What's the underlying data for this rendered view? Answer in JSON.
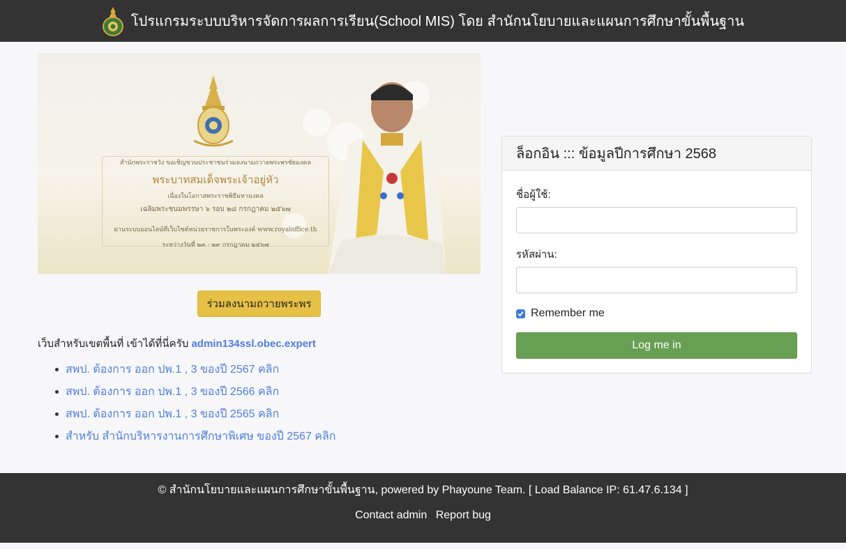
{
  "header": {
    "title": "โปรแกรมระบบบริหารจัดการผลการเรียน(School MIS) โดย สำนักนโยบายและแผนการศึกษาขั้นพื้นฐาน",
    "logo_icon": "obec-emblem-icon"
  },
  "banner": {
    "line1": "สำนักพระราชวัง ขอเชิญชวนประชาชนร่วมลงนามถวายพระพรชัยมงคล",
    "line2": "พระบาทสมเด็จพระเจ้าอยู่หัว",
    "line3": "เนื่องในโอกาสพระราชพิธีมหามงคล",
    "line4": "เฉลิมพระชนมพรรษา ๖ รอบ ๒๘ กรกฎาคม ๒๕๖๗",
    "line5": "ผ่านระบบออนไลน์ที่เว็บไซต์หน่วยราชการในพระองค์ www.royaloffice.th",
    "line6": "ระหว่างวันที่ ๒๓ - ๒๙ กรกฎาคม ๒๕๖๗"
  },
  "sign_button": "ร่วมลงนามถวายพระพร",
  "area_note": {
    "text": "เว็บสำหรับเขตพื้นที่ เข้าได้ที่นี่ครับ",
    "link": "admin134ssl.obec.expert"
  },
  "links": [
    "สพป. ต้องการ ออก ปพ.1 , 3 ของปี 2567 คลิก",
    "สพป. ต้องการ ออก ปพ.1 , 3 ของปี 2566 คลิก",
    "สพป. ต้องการ ออก ปพ.1 , 3 ของปี 2565 คลิก",
    "สำหรับ สำนักบริหารงานการศึกษาพิเศษ ของปี 2567 คลิก"
  ],
  "login": {
    "title": "ล็อกอิน ::: ข้อมูลปีการศึกษา 2568",
    "username_label": "ชื่อผู้ใช้:",
    "username_value": "",
    "password_label": "รหัสผ่าน:",
    "password_value": "",
    "remember_label": "Remember me",
    "remember_checked": true,
    "submit_label": "Log me in"
  },
  "footer": {
    "copyright": "© สำนักนโยบายและแผนการศึกษาขั้นพื้นฐาน, powered by Phayoune Team. [ Load Balance IP: 61.47.6.134 ]",
    "contact": "Contact admin",
    "report": "Report bug"
  },
  "colors": {
    "topbar": "#333333",
    "link": "#4c7de0",
    "sign_button": "#e6c145",
    "login_button": "#68a053"
  }
}
